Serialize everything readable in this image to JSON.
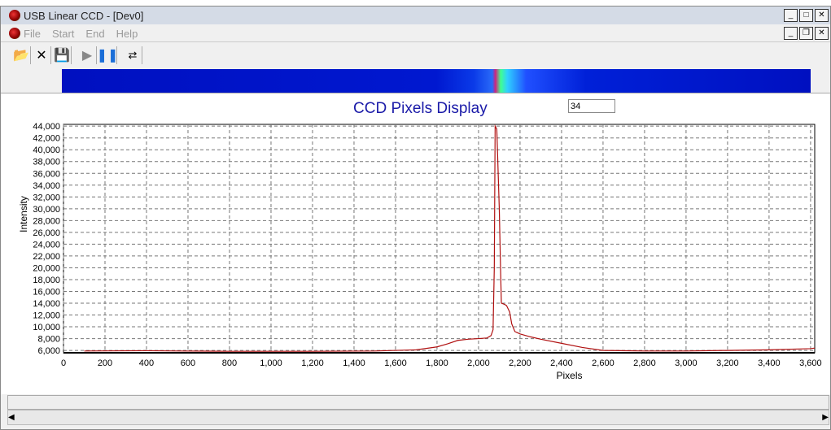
{
  "window": {
    "title": "USB Linear CCD - [Dev0]"
  },
  "menu": [
    "File",
    "Start",
    "End",
    "Help"
  ],
  "toolbar": [
    "open-icon",
    "close-x-icon",
    "save-icon",
    "play-icon",
    "pause-icon",
    "device-icon"
  ],
  "chart_box_value": "34",
  "chart_data": {
    "type": "line",
    "title": "CCD Pixels Display",
    "xlabel": "Pixels",
    "ylabel": "Intensity",
    "xlim": [
      0,
      3620
    ],
    "ylim": [
      5600,
      44300
    ],
    "xticks": [
      0,
      200,
      400,
      600,
      800,
      1000,
      1200,
      1400,
      1600,
      1800,
      2000,
      2200,
      2400,
      2600,
      2800,
      3000,
      3200,
      3400,
      3600
    ],
    "xtick_labels": [
      "0",
      "200",
      "400",
      "600",
      "800",
      "1,000",
      "1,200",
      "1,400",
      "1,600",
      "1,800",
      "2,000",
      "2,200",
      "2,400",
      "2,600",
      "2,800",
      "3,000",
      "3,200",
      "3,400",
      "3,600"
    ],
    "yticks": [
      6000,
      8000,
      10000,
      12000,
      14000,
      16000,
      18000,
      20000,
      22000,
      24000,
      26000,
      28000,
      30000,
      32000,
      34000,
      36000,
      38000,
      40000,
      42000,
      44000
    ],
    "ytick_labels": [
      "6,000",
      "8,000",
      "10,000",
      "12,000",
      "14,000",
      "16,000",
      "18,000",
      "20,000",
      "22,000",
      "24,000",
      "26,000",
      "28,000",
      "30,000",
      "32,000",
      "34,000",
      "36,000",
      "38,000",
      "40,000",
      "42,000",
      "44,000"
    ],
    "grid": true,
    "series": [
      {
        "name": "Intensity",
        "color": "#b01010",
        "x": [
          100,
          400,
          560,
          800,
          1200,
          1500,
          1700,
          1800,
          1850,
          1900,
          1950,
          2000,
          2040,
          2060,
          2070,
          2076,
          2080,
          2088,
          2100,
          2106,
          2110,
          2125,
          2135,
          2150,
          2160,
          2175,
          2200,
          2250,
          2300,
          2400,
          2500,
          2600,
          2800,
          3000,
          3200,
          3400,
          3600,
          3620
        ],
        "y": [
          5900,
          5950,
          5900,
          5850,
          5850,
          5900,
          6100,
          6600,
          7100,
          7700,
          7900,
          8000,
          8100,
          8500,
          9500,
          20000,
          44000,
          43500,
          30000,
          20000,
          14000,
          13800,
          13600,
          12500,
          10500,
          9200,
          8800,
          8300,
          7900,
          7200,
          6500,
          6000,
          5900,
          5900,
          6000,
          6100,
          6300,
          6400
        ]
      }
    ]
  }
}
